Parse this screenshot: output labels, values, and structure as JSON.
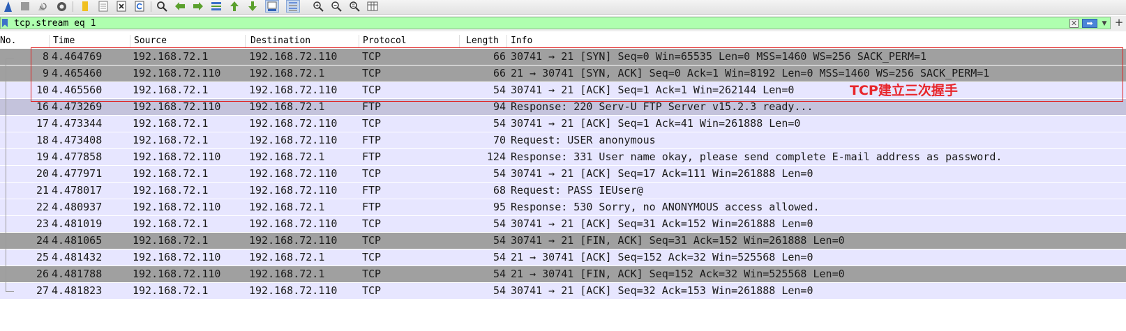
{
  "toolbar": {
    "icons": [
      "shark-fin-icon",
      "stop-icon",
      "restart-icon",
      "capture-options-icon",
      "open-folder-icon",
      "save-icon",
      "close-file-icon",
      "reload-icon",
      "find-icon",
      "go-back-icon",
      "go-forward-icon",
      "go-to-packet-icon",
      "first-packet-icon",
      "last-packet-icon",
      "autoscroll-icon",
      "colorize-icon",
      "zoom-in-icon",
      "zoom-out-icon",
      "normal-size-icon",
      "resize-columns-icon"
    ]
  },
  "filter": {
    "value": "tcp.stream eq 1",
    "background_color": "#afffaf"
  },
  "columns": [
    "No.",
    "Time",
    "Source",
    "Destination",
    "Protocol",
    "Length",
    "Info"
  ],
  "packets": [
    {
      "no": "8",
      "time": "4.464769",
      "source": "192.168.72.1",
      "destination": "192.168.72.110",
      "protocol": "TCP",
      "length": "66",
      "info": "30741 → 21 [SYN] Seq=0 Win=65535 Len=0 MSS=1460 WS=256 SACK_PERM=1",
      "color": "#a0a0a0"
    },
    {
      "no": "9",
      "time": "4.465460",
      "source": "192.168.72.110",
      "destination": "192.168.72.1",
      "protocol": "TCP",
      "length": "66",
      "info": "21 → 30741 [SYN, ACK] Seq=0 Ack=1 Win=8192 Len=0 MSS=1460 WS=256 SACK_PERM=1",
      "color": "#a0a0a0"
    },
    {
      "no": "10",
      "time": "4.465560",
      "source": "192.168.72.1",
      "destination": "192.168.72.110",
      "protocol": "TCP",
      "length": "54",
      "info": "30741 → 21 [ACK] Seq=1 Ack=1 Win=262144 Len=0",
      "color": "#e7e6ff"
    },
    {
      "no": "16",
      "time": "4.473269",
      "source": "192.168.72.110",
      "destination": "192.168.72.1",
      "protocol": "FTP",
      "length": "94",
      "info": "Response: 220 Serv-U FTP Server v15.2.3 ready...",
      "color": "#c4c3dc"
    },
    {
      "no": "17",
      "time": "4.473344",
      "source": "192.168.72.1",
      "destination": "192.168.72.110",
      "protocol": "TCP",
      "length": "54",
      "info": "30741 → 21 [ACK] Seq=1 Ack=41 Win=261888 Len=0",
      "color": "#e7e6ff"
    },
    {
      "no": "18",
      "time": "4.473408",
      "source": "192.168.72.1",
      "destination": "192.168.72.110",
      "protocol": "FTP",
      "length": "70",
      "info": "Request: USER anonymous",
      "color": "#e7e6ff"
    },
    {
      "no": "19",
      "time": "4.477858",
      "source": "192.168.72.110",
      "destination": "192.168.72.1",
      "protocol": "FTP",
      "length": "124",
      "info": "Response: 331 User name okay, please send complete E-mail address as password.",
      "color": "#e7e6ff"
    },
    {
      "no": "20",
      "time": "4.477971",
      "source": "192.168.72.1",
      "destination": "192.168.72.110",
      "protocol": "TCP",
      "length": "54",
      "info": "30741 → 21 [ACK] Seq=17 Ack=111 Win=261888 Len=0",
      "color": "#e7e6ff"
    },
    {
      "no": "21",
      "time": "4.478017",
      "source": "192.168.72.1",
      "destination": "192.168.72.110",
      "protocol": "FTP",
      "length": "68",
      "info": "Request: PASS IEUser@",
      "color": "#e7e6ff"
    },
    {
      "no": "22",
      "time": "4.480937",
      "source": "192.168.72.110",
      "destination": "192.168.72.1",
      "protocol": "FTP",
      "length": "95",
      "info": "Response: 530 Sorry, no ANONYMOUS access allowed.",
      "color": "#e7e6ff"
    },
    {
      "no": "23",
      "time": "4.481019",
      "source": "192.168.72.1",
      "destination": "192.168.72.110",
      "protocol": "TCP",
      "length": "54",
      "info": "30741 → 21 [ACK] Seq=31 Ack=152 Win=261888 Len=0",
      "color": "#e7e6ff"
    },
    {
      "no": "24",
      "time": "4.481065",
      "source": "192.168.72.1",
      "destination": "192.168.72.110",
      "protocol": "TCP",
      "length": "54",
      "info": "30741 → 21 [FIN, ACK] Seq=31 Ack=152 Win=261888 Len=0",
      "color": "#a0a0a0"
    },
    {
      "no": "25",
      "time": "4.481432",
      "source": "192.168.72.110",
      "destination": "192.168.72.1",
      "protocol": "TCP",
      "length": "54",
      "info": "21 → 30741 [ACK] Seq=152 Ack=32 Win=525568 Len=0",
      "color": "#e7e6ff"
    },
    {
      "no": "26",
      "time": "4.481788",
      "source": "192.168.72.110",
      "destination": "192.168.72.1",
      "protocol": "TCP",
      "length": "54",
      "info": "21 → 30741 [FIN, ACK] Seq=152 Ack=32 Win=525568 Len=0",
      "color": "#a0a0a0"
    },
    {
      "no": "27",
      "time": "4.481823",
      "source": "192.168.72.1",
      "destination": "192.168.72.110",
      "protocol": "TCP",
      "length": "54",
      "info": "30741 → 21 [ACK] Seq=32 Ack=153 Win=261888 Len=0",
      "color": "#e7e6ff"
    }
  ],
  "annotation": {
    "text": "TCP建立三次握手",
    "color": "#e8262b"
  }
}
